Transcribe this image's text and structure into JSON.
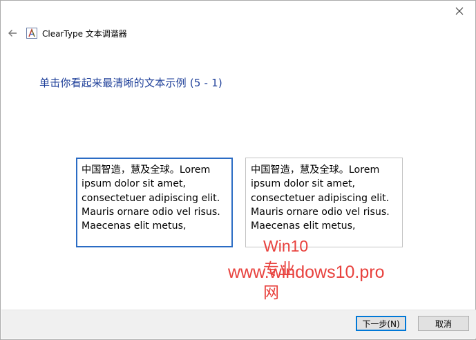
{
  "window": {
    "app_title": "ClearType 文本调谐器",
    "icon_letter": "A"
  },
  "instruction": "单击你看起来最清晰的文本示例 (5 - 1)",
  "samples": [
    {
      "lines": [
        "中国智造，慧及全球。Lorem",
        "ipsum dolor sit amet,",
        "consectetuer adipiscing elit.",
        "Mauris ornare odio vel risus.",
        "Maecenas elit metus,"
      ],
      "selected": true
    },
    {
      "lines": [
        "中国智造，慧及全球。Lorem",
        "ipsum dolor sit amet,",
        "consectetuer adipiscing elit.",
        "Mauris ornare odio vel risus.",
        "Maecenas elit metus,"
      ],
      "selected": false
    }
  ],
  "watermark": {
    "line1": "Win10专业网",
    "line2": "www.windows10.pro"
  },
  "footer": {
    "next_label": "下一步(N)",
    "cancel_label": "取消"
  },
  "colors": {
    "instruction": "#1e3f99",
    "selection_border": "#2b6cc4",
    "watermark": "#e8413d"
  }
}
